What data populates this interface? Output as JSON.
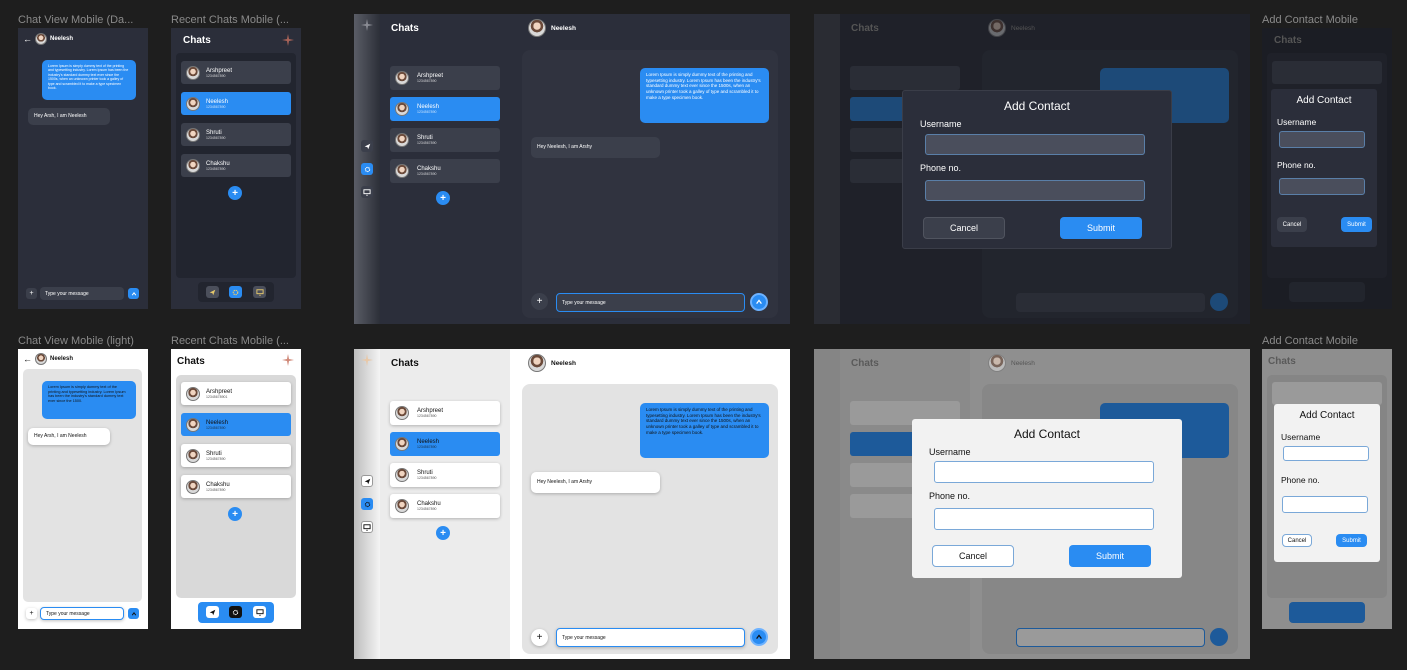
{
  "labels": {
    "chat_dark": "Chat View Mobile (Da...",
    "recent_dark": "Recent Chats Mobile (...",
    "add_contact_dark": "Add Contact Mobile",
    "chat_light": "Chat View Mobile (light)",
    "recent_light": "Recent Chats Mobile (...",
    "add_contact_light": "Add Contact Mobile"
  },
  "header": {
    "chats_title": "Chats",
    "contact_name": "Neelesh",
    "back_arrow": "←"
  },
  "contacts": [
    {
      "name": "Arshpreet",
      "phone": "1234567890"
    },
    {
      "name": "Neelesh",
      "phone": "1234567890"
    },
    {
      "name": "Shruti",
      "phone": "1234567890"
    },
    {
      "name": "Chakshu",
      "phone": "1234567890"
    }
  ],
  "contacts_light_mobile_phone": "12345678901",
  "messages": {
    "sent": "Lorem Ipsum is simply dummy text of the printing and typesetting industry. Lorem Ipsum has been the industry's standard dummy text ever since the 1500s, when an unknown printer took a galley of type and scrambled it to make a type specimen book.",
    "sent_light_mobile": "Lorem Ipsum is simply dummy text of the printing and typesetting industry. Lorem Ipsum has been the industry's standard dummy text ever since the 1500.",
    "received_mobile": "Hey Arsh, I am Neelesh",
    "received_desktop": "Hey Neelesh, I am Arshy"
  },
  "composer": {
    "placeholder": "Type your message",
    "plus": "+"
  },
  "modal": {
    "title": "Add Contact",
    "username_label": "Username",
    "phone_label": "Phone no.",
    "cancel": "Cancel",
    "submit": "Submit"
  },
  "icons": {
    "send": "send-icon",
    "settings": "gear-icon",
    "monitor": "monitor-icon",
    "add": "plus-icon",
    "logo": "compass-logo-icon"
  },
  "colors": {
    "accent": "#2a8cf2",
    "dark_bg": "#2b2e3a",
    "dark_card": "#3b3f4b",
    "light_bg": "#ffffff",
    "light_panel": "#e6e6e6"
  }
}
